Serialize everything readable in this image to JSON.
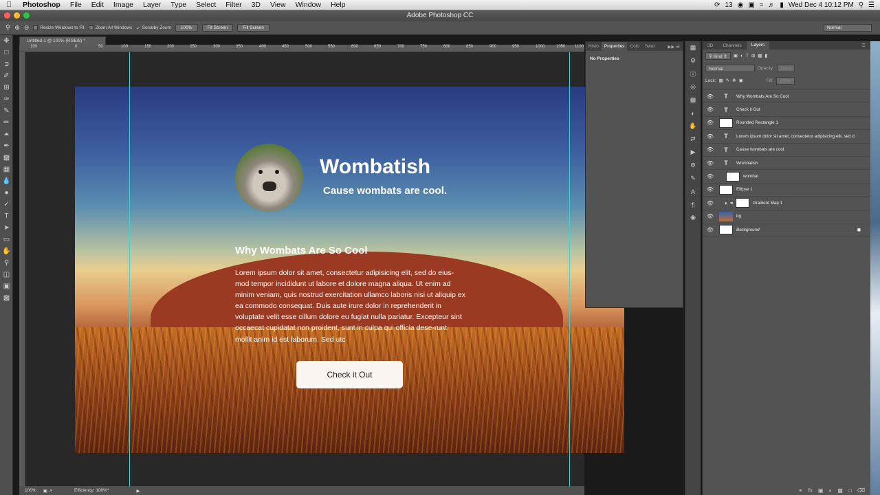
{
  "menubar": {
    "app_name": "Photoshop",
    "items": [
      "File",
      "Edit",
      "Image",
      "Layer",
      "Type",
      "Select",
      "Filter",
      "3D",
      "View",
      "Window",
      "Help"
    ],
    "clock": "Wed Dec 4  10:12 PM",
    "badge": "13"
  },
  "window": {
    "title": "Adobe Photoshop CC"
  },
  "options": {
    "resize_label": "Resize Windows to Fit",
    "zoom_all_label": "Zoom All Windows",
    "scrubby_label": "Scrubby Zoom",
    "zoom_value": "100%",
    "fit_screen": "Fit Screen",
    "fill_screen": "Fill Screen",
    "workspace": "Normal"
  },
  "document": {
    "tab": "Untitled-1 @ 100% (RGB/8) *",
    "ruler_ticks": [
      "100",
      "0",
      "50",
      "100",
      "150",
      "200",
      "250",
      "300",
      "350",
      "400",
      "450",
      "500",
      "550",
      "600",
      "650",
      "700",
      "750",
      "800",
      "850",
      "900",
      "950",
      "1000",
      "1050",
      "1100"
    ]
  },
  "canvas": {
    "site_title": "Wombatish",
    "tagline": "Cause wombats are cool.",
    "section_heading": "Why Wombats Are So Cool",
    "body": "Lorem ipsum dolor sit amet, consectetur adipisicing elit, sed do eius-mod tempor incididunt ut labore et dolore magna aliqua. Ut enim ad minim veniam, quis nostrud exercitation ullamco laboris nisi ut aliquip ex ea commodo consequat. Duis aute irure dolor in reprehenderit in voluptate velit esse cillum dolore eu fugiat nulla pariatur. Excepteur sint occaecat cupidatat non proident, sunt in culpa qui officia dese-runt mollit anim id est laborum. Sed utc",
    "button": "Check it Out"
  },
  "status": {
    "zoom": "100%",
    "efficiency": "Efficiency: 100%*"
  },
  "properties_panel": {
    "tabs": [
      "Histo",
      "Properties",
      "Colo",
      "Swat"
    ],
    "content": "No Properties"
  },
  "layers_panel": {
    "tabs": [
      "3D",
      "Channels",
      "Layers"
    ],
    "filter": "Kind",
    "blend_mode": "Normal",
    "opacity_label": "Opacity:",
    "opacity": "100%",
    "lock_label": "Lock:",
    "fill_label": "Fill:",
    "fill": "100%",
    "layers": [
      {
        "name": "Why Wombats Are So Cool",
        "kind": "T"
      },
      {
        "name": "Check it Out",
        "kind": "T"
      },
      {
        "name": "Rounded Rectangle 1",
        "kind": "img"
      },
      {
        "name": "Lorem ipsum dolor sit amet, consectetur adipisicing elit, sed d",
        "kind": "T"
      },
      {
        "name": "Cause wombats are cool.",
        "kind": "T"
      },
      {
        "name": "Wombatish",
        "kind": "T"
      },
      {
        "name": "wombat",
        "kind": "img"
      },
      {
        "name": "Ellipse 1",
        "kind": "img"
      },
      {
        "name": "Gradient Map 1",
        "kind": "img"
      },
      {
        "name": "bg",
        "kind": "bg"
      },
      {
        "name": "Background",
        "kind": "img"
      }
    ]
  },
  "colors": {
    "guide": "#3fd0cf",
    "panel": "#535353",
    "pasteboard": "#282828"
  }
}
